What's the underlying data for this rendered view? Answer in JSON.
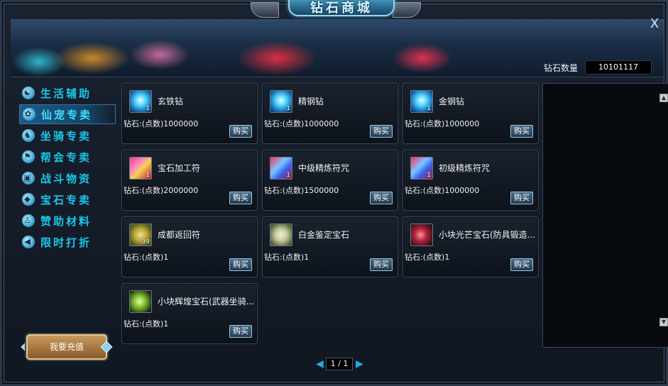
{
  "window": {
    "title": "钻石商城",
    "close_label": "X"
  },
  "balance": {
    "label": "钻石数量",
    "value": "10101117"
  },
  "sidebar": {
    "items": [
      {
        "label": "生活辅助",
        "icon": "life-icon",
        "glyph": "☯"
      },
      {
        "label": "仙宠专卖",
        "icon": "pet-paw-icon",
        "glyph": "✿",
        "active": true
      },
      {
        "label": "坐骑专卖",
        "icon": "mount-icon",
        "glyph": "♞"
      },
      {
        "label": "帮会专卖",
        "icon": "guild-icon",
        "glyph": "⚑"
      },
      {
        "label": "战斗物资",
        "icon": "battle-supply-icon",
        "glyph": "▣"
      },
      {
        "label": "宝石专卖",
        "icon": "gem-icon",
        "glyph": "◆"
      },
      {
        "label": "赞助材料",
        "icon": "sponsor-icon",
        "glyph": "♙"
      },
      {
        "label": "限时打折",
        "icon": "megaphone-icon",
        "glyph": "◀"
      }
    ]
  },
  "recharge": {
    "label": "我要充值"
  },
  "products": [
    {
      "name": "玄铁钻",
      "price": "钻石:(点数)1000000",
      "count": "1",
      "icon": "icon-gem",
      "buy": "购买"
    },
    {
      "name": "精钢钻",
      "price": "钻石:(点数)1000000",
      "count": "1",
      "icon": "icon-gem",
      "buy": "购买"
    },
    {
      "name": "金钢钻",
      "price": "钻石:(点数)1000000",
      "count": "1",
      "icon": "icon-gem",
      "buy": "购买"
    },
    {
      "name": "宝石加工符",
      "price": "钻石:(点数)2000000",
      "count": "1",
      "icon": "icon-scroll",
      "buy": "购买"
    },
    {
      "name": "中级精炼符咒",
      "price": "钻石:(点数)1500000",
      "count": "1",
      "icon": "icon-scroll2",
      "buy": "购买"
    },
    {
      "name": "初级精炼符咒",
      "price": "钻石:(点数)1000000",
      "count": "1",
      "icon": "icon-scroll2",
      "buy": "购买"
    },
    {
      "name": "成都返回符",
      "price": "钻石:(点数)1",
      "count": "99",
      "icon": "icon-return",
      "buy": "购买"
    },
    {
      "name": "白金鉴定宝石",
      "price": "钻石:(点数)1",
      "count": "",
      "icon": "icon-white",
      "buy": "购买"
    },
    {
      "name": "小块光芒宝石(防具锻造...",
      "price": "钻石:(点数)1",
      "count": "",
      "icon": "icon-red",
      "buy": "购买"
    },
    {
      "name": "小块辉煌宝石(武器坐骑...",
      "price": "钻石:(点数)1",
      "count": "",
      "icon": "icon-green",
      "buy": "购买"
    }
  ],
  "pager": {
    "current": "1",
    "total": "1",
    "text": "1 / 1",
    "prev": "◀",
    "next": "▶"
  },
  "scroll": {
    "up": "▲",
    "down": "▼"
  }
}
